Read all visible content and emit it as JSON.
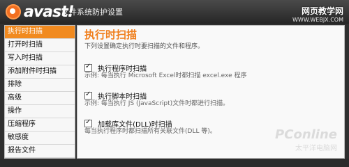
{
  "window": {
    "brand": "avast!",
    "title": "文件系统防护设置",
    "watermark_top": "网页教学网",
    "watermark_top_url": "WWW.WEBJX.COM"
  },
  "sidebar": {
    "items": [
      {
        "label": "执行时扫描",
        "active": true
      },
      {
        "label": "打开时扫描",
        "active": false
      },
      {
        "label": "写入时扫描",
        "active": false
      },
      {
        "label": "添加附件时扫描",
        "active": false
      },
      {
        "label": "排除",
        "active": false
      },
      {
        "label": "高级",
        "active": false
      },
      {
        "label": "操作",
        "active": false
      },
      {
        "label": "压缩程序",
        "active": false
      },
      {
        "label": "敏感度",
        "active": false
      },
      {
        "label": "报告文件",
        "active": false
      }
    ]
  },
  "main": {
    "title": "执行时扫描",
    "subtitle": "下列设置确定执行时要扫描的文件和程序。",
    "options": [
      {
        "label": "执行程序时扫描",
        "desc": "示例: 每当执行 Microsoft Excel时都扫描 excel.exe 程序",
        "checked": true
      },
      {
        "label": "执行脚本时扫描",
        "desc": "示例: 每当执行 JS (JavaScript)文件时都进行扫描。",
        "checked": true
      },
      {
        "label": "加载库文件(DLL)时扫描",
        "desc": "每当执行程序时都扫描所有关联文件(DLL 等)。",
        "checked": true
      }
    ]
  },
  "watermark_bottom": {
    "brand": "PConline",
    "cn": "太平洋电脑网"
  },
  "colors": {
    "accent": "#f18a1f",
    "title_bar": "#2f2f2f"
  }
}
